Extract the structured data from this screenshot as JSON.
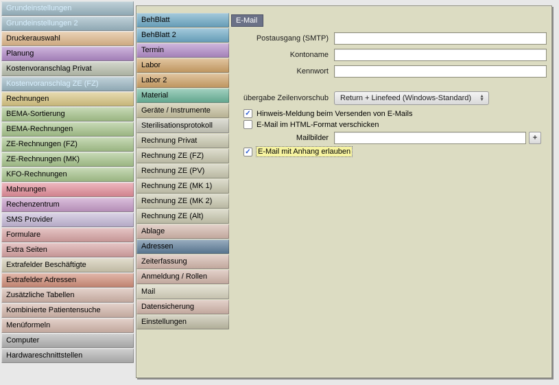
{
  "sidebar_left": {
    "items": [
      {
        "label": "Grundeinstellungen",
        "bg": "#9bb6c2",
        "hl": true
      },
      {
        "label": "Grundeinstellungen 2",
        "bg": "#9bb6c2",
        "hl": true
      },
      {
        "label": "Druckerauswahl",
        "bg": "#deb88c"
      },
      {
        "label": "Planung",
        "bg": "#b089c6"
      },
      {
        "label": "Kostenvoranschlag Privat",
        "bg": "#b9bfae"
      },
      {
        "label": "Kostenvoranschlag ZE (FZ)",
        "bg": "#9bb6c2",
        "hl": true
      },
      {
        "label": "Rechnungen",
        "bg": "#d7c583"
      },
      {
        "label": "BEMA-Sortierung",
        "bg": "#a7c48d"
      },
      {
        "label": "BEMA-Rechnungen",
        "bg": "#a7c48d"
      },
      {
        "label": "ZE-Rechnungen (FZ)",
        "bg": "#a7c48d"
      },
      {
        "label": "ZE-Rechnungen (MK)",
        "bg": "#a7c48d"
      },
      {
        "label": "KFO-Rechnungen",
        "bg": "#a7c48d"
      },
      {
        "label": "Mahnungen",
        "bg": "#e28e9a"
      },
      {
        "label": "Rechenzentrum",
        "bg": "#c49ac6"
      },
      {
        "label": "SMS Provider",
        "bg": "#c4b8d6"
      },
      {
        "label": "Formulare",
        "bg": "#d6a3a3"
      },
      {
        "label": "Extra Seiten",
        "bg": "#d6a3a3"
      },
      {
        "label": "Extrafelder Beschäftigte",
        "bg": "#d0c9b1"
      },
      {
        "label": "Extrafelder Adressen",
        "bg": "#d08e7a"
      },
      {
        "label": "Zusätzliche Tabellen",
        "bg": "#d2b6ab"
      },
      {
        "label": "Kombinierte Patientensuche",
        "bg": "#d2b6ab"
      },
      {
        "label": "Menüformeln",
        "bg": "#d2b6ab"
      },
      {
        "label": "Computer",
        "bg": "#b3b3b3"
      },
      {
        "label": "Hardwareschnittstellen",
        "bg": "#b3b3b3"
      }
    ]
  },
  "sidebar_mid": {
    "items": [
      {
        "label": "BehBlatt",
        "bg": "#6faac6"
      },
      {
        "label": "BehBlatt 2",
        "bg": "#6faac6"
      },
      {
        "label": "Termin",
        "bg": "#b28cc8"
      },
      {
        "label": "Labor",
        "bg": "#cfa369"
      },
      {
        "label": "Labor 2",
        "bg": "#cfa369"
      },
      {
        "label": "Material",
        "bg": "#6cb59b"
      },
      {
        "label": "Geräte / Instrumente",
        "bg": "#c6c09f"
      },
      {
        "label": "Sterilisationsprotokoll",
        "bg": "#c9c9bb"
      },
      {
        "label": "Rechnung Privat",
        "bg": "#c9c8b0"
      },
      {
        "label": "Rechnung ZE (FZ)",
        "bg": "#c9c8b0"
      },
      {
        "label": "Rechnung ZE (PV)",
        "bg": "#c9c8b0"
      },
      {
        "label": "Rechnung ZE (MK 1)",
        "bg": "#c9c8b0"
      },
      {
        "label": "Rechnung ZE (MK 2)",
        "bg": "#c9c8b0"
      },
      {
        "label": "Rechnung ZE (Alt)",
        "bg": "#c9c8b0"
      },
      {
        "label": "Ablage",
        "bg": "#d2b6ab"
      },
      {
        "label": "Adressen",
        "bg": "#5f7e9a"
      },
      {
        "label": "Zeiterfassung",
        "bg": "#d2b6ab"
      },
      {
        "label": "Anmeldung / Rollen",
        "bg": "#d2b6ab"
      },
      {
        "label": "Mail",
        "bg": "#d6d2bd",
        "active": true
      },
      {
        "label": "Datensicherung",
        "bg": "#d2b6ab"
      },
      {
        "label": "Einstellungen",
        "bg": "#c0bda6"
      }
    ]
  },
  "form": {
    "section_title": "E-Mail",
    "smtp_label": "Postausgang (SMTP)",
    "smtp_value": "",
    "account_label": "Kontoname",
    "account_value": "",
    "password_label": "Kennwort",
    "password_value": "",
    "linefeed_label": "übergabe Zeilenvorschub",
    "linefeed_value": "Return + Linefeed (Windows-Standard)",
    "hint_checked": true,
    "hint_label": "Hinweis-Meldung beim Versenden von E-Mails",
    "html_checked": false,
    "html_label": "E-Mail im HTML-Format verschicken",
    "mailbilder_label": "Mailbilder",
    "mailbilder_value": "",
    "plus_label": "+",
    "attach_checked": true,
    "attach_label": "E-Mail mit Anhang erlauben"
  }
}
